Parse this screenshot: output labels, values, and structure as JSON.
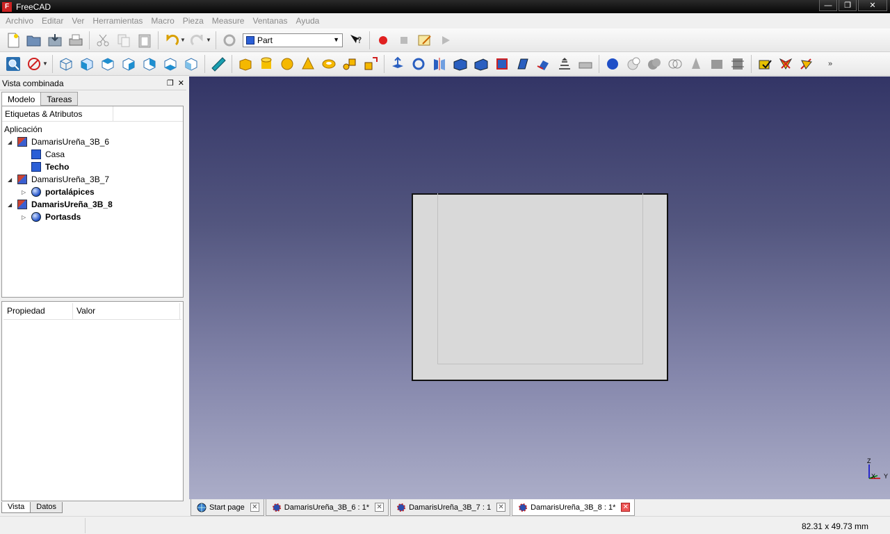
{
  "window": {
    "title": "FreeCAD",
    "icon": "freecad-logo-icon",
    "controls": [
      "minimize-icon",
      "restore-icon",
      "close-icon"
    ]
  },
  "menu": [
    "Archivo",
    "Editar",
    "Ver",
    "Herramientas",
    "Macro",
    "Pieza",
    "Measure",
    "Ventanas",
    "Ayuda"
  ],
  "toolbar": {
    "workbench": "Part"
  },
  "combo": {
    "title": "Vista combinada",
    "tabs": [
      "Modelo",
      "Tareas"
    ],
    "tree_header": "Etiquetas & Atributos",
    "tree_root": "Aplicación",
    "tree": [
      {
        "label": "DamarisUreña_3B_6",
        "icon": "document-icon",
        "bold": false
      },
      {
        "label": "Casa",
        "icon": "cube-icon",
        "bold": false
      },
      {
        "label": "Techo",
        "icon": "cube-icon",
        "bold": true
      },
      {
        "label": "DamarisUreña_3B_7",
        "icon": "document-icon",
        "bold": false
      },
      {
        "label": "portalápices",
        "icon": "sphere-shape-icon",
        "bold": true
      },
      {
        "label": "DamarisUreña_3B_8",
        "icon": "document-icon",
        "bold": true
      },
      {
        "label": "Portasds",
        "icon": "sphere-shape-icon",
        "bold": true
      }
    ],
    "props_headers": [
      "Propiedad",
      "Valor"
    ],
    "bottom_tabs": [
      "Vista",
      "Datos"
    ]
  },
  "view": {
    "axis_labels": {
      "z": "Z",
      "x": "X",
      "y": "Y"
    },
    "bg_top": "#333566",
    "bg_bottom": "#abadc8"
  },
  "doc_tabs": [
    {
      "label": "Start page",
      "icon": "globe-icon"
    },
    {
      "label": "DamarisUreña_3B_6 : 1*",
      "icon": "gear-icon"
    },
    {
      "label": "DamarisUreña_3B_7 : 1",
      "icon": "gear-icon"
    },
    {
      "label": "DamarisUreña_3B_8 : 1*",
      "icon": "gear-icon"
    }
  ],
  "status": {
    "dimensions": "82.31 x 49.73 mm"
  }
}
